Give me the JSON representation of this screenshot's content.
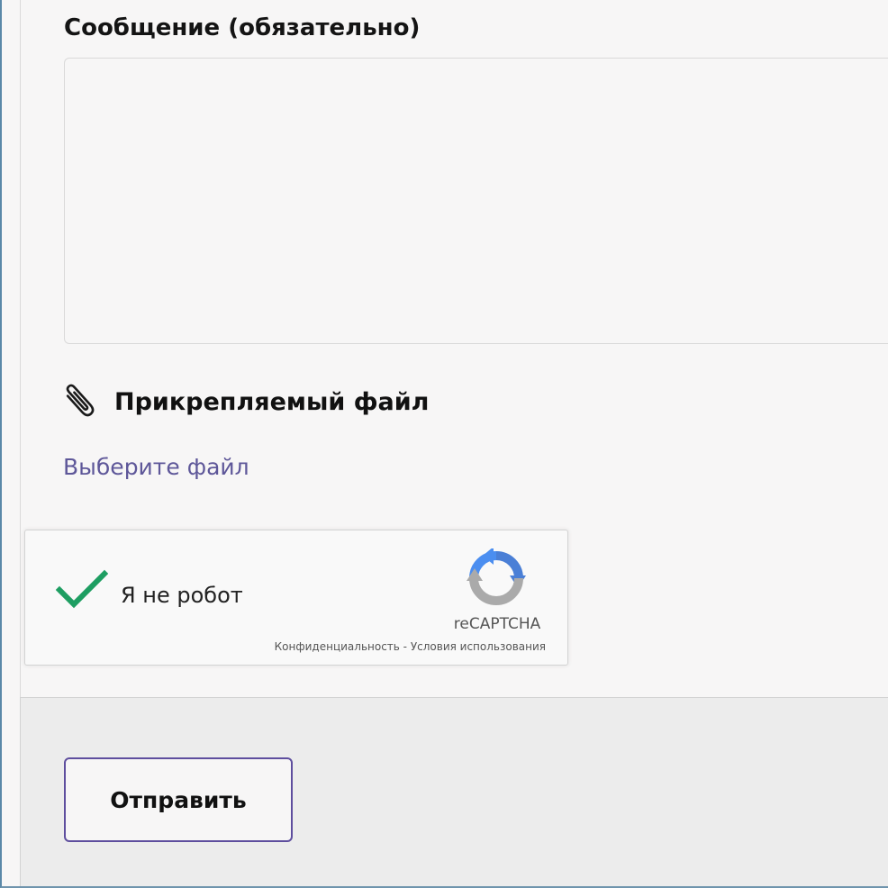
{
  "form": {
    "message_label": "Сообщение (обязательно)",
    "message_value": "",
    "attachment_label": "Прикрепляемый файл",
    "choose_file_link": "Выберите файл"
  },
  "captcha": {
    "checkbox_label": "Я не робот",
    "checked": true,
    "brand": "reCAPTCHA",
    "privacy_link": "Конфиденциальность",
    "separator": " - ",
    "terms_link": "Условия использования"
  },
  "footer": {
    "submit_label": "Отправить"
  },
  "colors": {
    "page_background": "#f7f6f6",
    "footer_background": "#ececec",
    "link_color": "#5e5799",
    "button_border": "#5e4e9e",
    "check_green": "#1e9e62",
    "recaptcha_blue": "#4a7fd6",
    "recaptcha_gray": "#aaaaaa",
    "frame_border": "#5a88a8"
  },
  "icons": {
    "attachment": "paperclip-icon",
    "captcha_check": "checkmark-icon",
    "captcha_logo": "recaptcha-logo-icon"
  }
}
